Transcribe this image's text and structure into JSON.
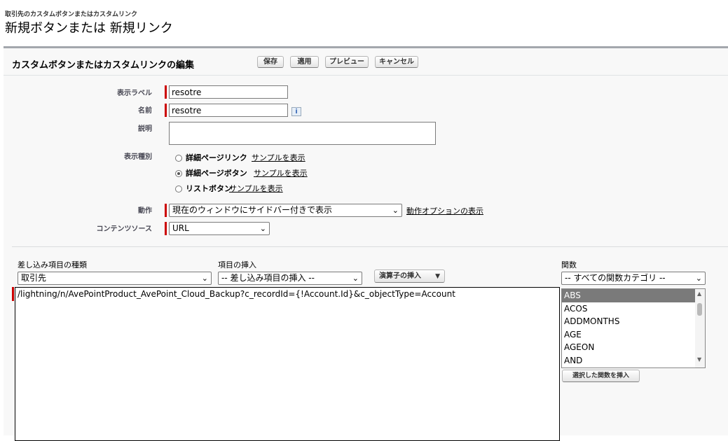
{
  "breadcrumb": "取引先のカスタムボタンまたはカスタムリンク",
  "page_title": "新規ボタンまたは 新規リンク",
  "panel": {
    "title": "カスタムボタンまたはカスタムリンクの編集",
    "buttons": {
      "save": "保存",
      "apply": "適用",
      "preview": "プレビュー",
      "cancel": "キャンセル"
    }
  },
  "form": {
    "display_label": {
      "label": "表示ラベル",
      "value": "resotre"
    },
    "name": {
      "label": "名前",
      "value": "resotre"
    },
    "description": {
      "label": "説明",
      "value": ""
    },
    "display_type": {
      "label": "表示種別",
      "options": [
        {
          "text": "詳細ページリンク",
          "link": "サンプルを表示",
          "selected": false
        },
        {
          "text": "詳細ページボタン",
          "link": "サンプルを表示",
          "selected": true
        },
        {
          "text": "リストボタン",
          "link": "サンプルを表示",
          "selected": false
        }
      ]
    },
    "behavior": {
      "label": "動作",
      "value": "現在のウィンドウにサイドバー付きで表示",
      "link": "動作オプションの表示"
    },
    "content_source": {
      "label": "コンテンツソース",
      "value": "URL"
    }
  },
  "formula": {
    "merge_type_label": "差し込み項目の種類",
    "merge_type_value": "取引先",
    "insert_field_label": "項目の挿入",
    "insert_field_value": "-- 差し込み項目の挿入 --",
    "operator_button": "演算子の挿入",
    "functions_label": "関数",
    "functions_category": "-- すべての関数カテゴリ --",
    "functions": [
      "ABS",
      "ACOS",
      "ADDMONTHS",
      "AGE",
      "AGEON",
      "AND"
    ],
    "insert_function_button": "選択した関数を挿入",
    "editor_text": "/lightning/n/AvePointProduct_AvePoint_Cloud_Backup?c_recordId={!Account.Id}&c_objectType=Account"
  }
}
